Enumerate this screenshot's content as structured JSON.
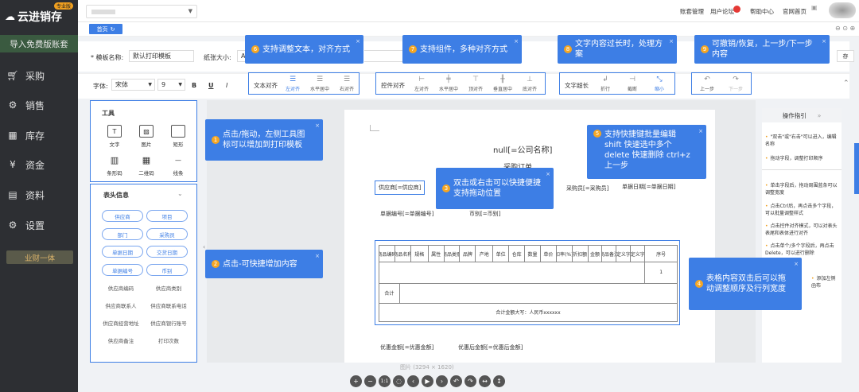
{
  "brand": {
    "name": "云进销存",
    "edition": "专业版"
  },
  "sidebar": {
    "import_label": "导入免费版账套",
    "items": [
      {
        "label": "采购",
        "icon": "cart-icon"
      },
      {
        "label": "销售",
        "icon": "sales-icon"
      },
      {
        "label": "库存",
        "icon": "warehouse-icon"
      },
      {
        "label": "资金",
        "icon": "yen-icon"
      },
      {
        "label": "资料",
        "icon": "document-icon"
      },
      {
        "label": "设置",
        "icon": "gear-icon"
      }
    ],
    "badge_label": "业财一体"
  },
  "topbar": {
    "links": [
      "账套管理",
      "用户论坛",
      "帮助中心",
      "官网首页"
    ]
  },
  "tabs": {
    "home_label": "首页"
  },
  "form": {
    "template_name_label": "* 模板名称:",
    "template_name_value": "默认打印模板",
    "paper_size_label": "纸张大小:",
    "paper_size_value": "A"
  },
  "toolbar": {
    "font_label": "字体:",
    "font_value": "宋体",
    "size_value": "9",
    "bold": "B",
    "underline": "U",
    "italic": "I",
    "text_align": {
      "label": "文本对齐",
      "options": [
        "左对齐",
        "水平居中",
        "右对齐"
      ]
    },
    "control_align": {
      "label": "控件对齐",
      "options": [
        "左对齐",
        "水平居中",
        "顶对齐",
        "垂直居中",
        "底对齐"
      ]
    },
    "overflow": {
      "label": "文字超长",
      "options": [
        "折行",
        "截断",
        "缩小"
      ]
    },
    "history": {
      "options": [
        "上一步",
        "下一步"
      ]
    }
  },
  "tools": {
    "title": "工具",
    "items": [
      "文字",
      "图片",
      "矩形",
      "条形码",
      "二维码",
      "线条"
    ]
  },
  "header_info": {
    "title": "表头信息",
    "chips": [
      "供应商",
      "项目",
      "部门",
      "采购员",
      "单据日期",
      "交货日期",
      "单据编号",
      "币别"
    ],
    "plain": [
      "供应商编码",
      "供应商类别",
      "供应商联系人",
      "供应商联系电话",
      "供应商经营地址",
      "供应商银行账号",
      "供应商备注",
      "打印次数"
    ]
  },
  "paper": {
    "company": "null[=公司名称]",
    "doc_title": "采购订单",
    "supplier": "供应商[=供应商]",
    "buyer": "采购员[=采购员]",
    "doc_date": "单据日期[=单据日期]",
    "doc_no": "单据编号[=单据编号]",
    "currency": "币别[=币别]",
    "table_headers": [
      "商品编码",
      "商品名称",
      "规格",
      "属性",
      "商品类别",
      "品牌",
      "产地",
      "单位",
      "仓库",
      "数量",
      "单价",
      "扣率(%)",
      "折扣额",
      "金额",
      "商品备注",
      "自定义字段",
      "自定义字段",
      "序号"
    ],
    "row_index": "1",
    "total_label": "合计",
    "total_upper": "合计金额大写：人民币xxxxxx",
    "discount": "优惠金额[=优惠金额]",
    "after_discount": "优惠后金额[=优惠后金额]",
    "caption": "图片 (3294 × 1620)"
  },
  "help": {
    "title": "操作指引",
    "items": [
      "\"双击\"或\"右击\"可以进入，编辑名称",
      "拖动字段，调整打印顺序",
      "单击字段后，拖动周围蓝条可以调整宽度",
      "点击Ctrl后，再点击多个字段，可以批量调整样式",
      "点击控件对齐模式，可以对表头表尾和表体进行对齐",
      "点击单个/多个字段后，再点击Delete，可以进行删除",
      "添加左侧函布"
    ]
  },
  "callouts": [
    {
      "num": "1",
      "text": "点击/拖动，左侧工具图标可以增加到打印模板"
    },
    {
      "num": "2",
      "text": "点击-可快捷增加内容"
    },
    {
      "num": "3",
      "text": "双击或右击可以快捷便捷支持拖动位置"
    },
    {
      "num": "4",
      "text": "表格内容双击后可以拖动调整顺序及行列宽度"
    },
    {
      "num": "5",
      "text": "支持快捷键批量编辑 shift 快速选中多个 delete 快速删除 ctrl+z 上一步"
    },
    {
      "num": "6",
      "text": "支持调整文本，对齐方式"
    },
    {
      "num": "7",
      "text": "支持组件，多种对齐方式"
    },
    {
      "num": "8",
      "text": "文字内容过长时，处理方案"
    },
    {
      "num": "9",
      "text": "可撤销/恢复，上一步/下一步内容"
    }
  ],
  "colors": {
    "accent": "#3d7ee5",
    "nav_bg": "#2d2f33",
    "number_badge": "#f5a623"
  }
}
